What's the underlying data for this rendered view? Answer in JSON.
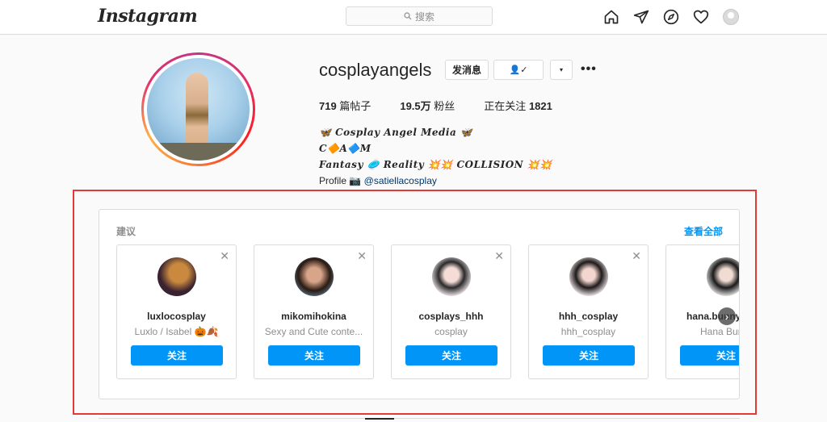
{
  "nav": {
    "logo": "Instagram",
    "search_placeholder": "搜索",
    "icons": [
      "home-icon",
      "direct-icon",
      "explore-icon",
      "heart-icon",
      "profile-avatar"
    ]
  },
  "profile": {
    "username": "cosplayangels",
    "message_button": "发消息",
    "following_button": "👤✓",
    "dropdown": "▾",
    "more": "•••",
    "stats": {
      "posts_value": "719",
      "posts_label": "篇帖子",
      "followers_value": "19.5万",
      "followers_label": "粉丝",
      "following_label": "正在关注",
      "following_value": "1821"
    },
    "bio": {
      "line1": "🦋 𝑪𝒐𝒔𝒑𝒍𝒂𝒚 𝑨𝒏𝒈𝒆𝒍 𝑴𝒆𝒅𝒊𝒂 🦋",
      "line2": "C🔶A🔷M",
      "line3": "Fantasy 🥏 Reality 💥💥 COLLISION 💥💥",
      "line4_prefix": "Profile 📷",
      "line4_link": "@satiellacosplay"
    }
  },
  "suggestions": {
    "title": "建议",
    "see_all": "查看全部",
    "follow_label": "关注",
    "close_symbol": "✕",
    "next_symbol": "›",
    "cards": [
      {
        "name": "luxlocosplay",
        "sub": "Luxlo / Isabel 🎃🍂",
        "avatar_color": "#3a2230",
        "accent": "#c9893e"
      },
      {
        "name": "mikomihokina",
        "sub": "Sexy and Cute conte...",
        "avatar_color": "#2a1a12",
        "accent": "#6a9ab8"
      },
      {
        "name": "cosplays_hhh",
        "sub": "cosplay",
        "avatar_color": "#f0e6ea",
        "accent": "#2a2a2a"
      },
      {
        "name": "hhh_cosplay",
        "sub": "hhh_cosplay",
        "avatar_color": "#f3e9ec",
        "accent": "#1e1a1a"
      },
      {
        "name": "hana.bunny_",
        "sub": "Hana Bun",
        "avatar_color": "#e8e4e4",
        "accent": "#1a1a1a"
      }
    ]
  }
}
